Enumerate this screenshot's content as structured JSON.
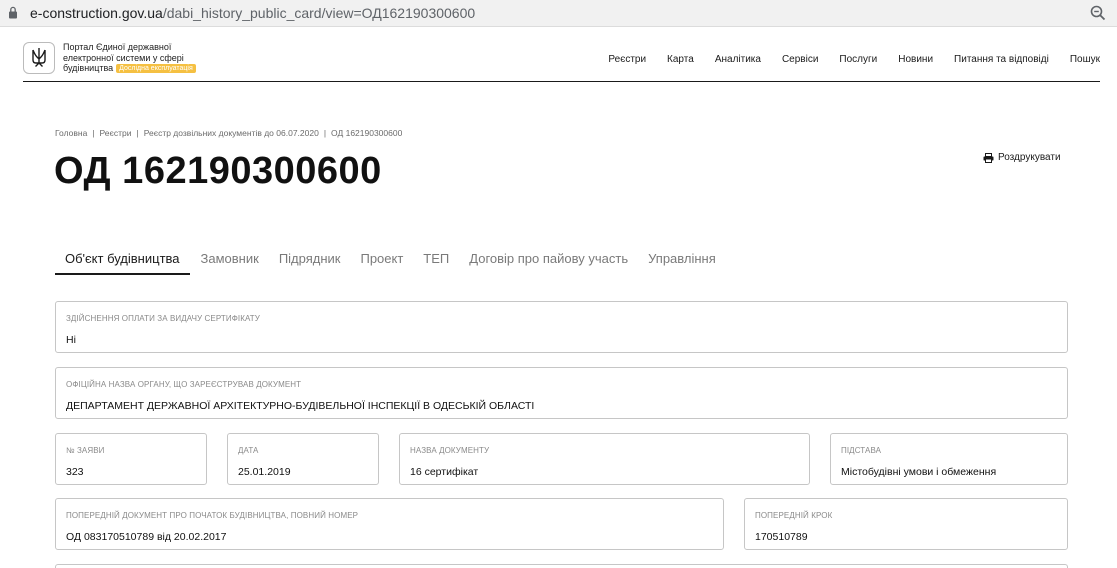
{
  "browser": {
    "url_domain": "e-construction.gov.ua",
    "url_path": "/dabi_history_public_card/view=ОД162190300600"
  },
  "header": {
    "portal_line1": "Портал Єдиної державної",
    "portal_line2": "електронної системи у сфері",
    "portal_line3": "будівництва",
    "badge": "Дослідна експлуатація",
    "nav": [
      "Реєстри",
      "Карта",
      "Аналітика",
      "Сервіси",
      "Послуги",
      "Новини",
      "Питання та відповіді",
      "Пошук"
    ]
  },
  "breadcrumb": [
    "Головна",
    "Реєстри",
    "Реєстр дозвільних документів до 06.07.2020",
    "ОД 162190300600"
  ],
  "page": {
    "title": "ОД 162190300600",
    "print_label": "Роздрукувати"
  },
  "tabs": [
    "Об'єкт будівництва",
    "Замовник",
    "Підрядник",
    "Проект",
    "ТЕП",
    "Договір про пайову участь",
    "Управління"
  ],
  "active_tab": "Об'єкт будівництва",
  "fields": {
    "payment": {
      "label": "Здійснення оплати за видачу сертифікату",
      "value": "Ні"
    },
    "authority": {
      "label": "Офіційна назва органу, що зареєстрував документ",
      "value": "ДЕПАРТАМЕНТ ДЕРЖАВНОЇ АРХІТЕКТУРНО-БУДІВЕЛЬНОЇ ІНСПЕКЦІЇ В ОДЕСЬКІЙ ОБЛАСТІ"
    },
    "application_no": {
      "label": "№ заяви",
      "value": "323"
    },
    "date": {
      "label": "Дата",
      "value": "25.01.2019"
    },
    "doc_name": {
      "label": "Назва документу",
      "value": "16 сертифікат"
    },
    "basis": {
      "label": "Підстава",
      "value": "Містобудівні умови і обмеження"
    },
    "prev_doc": {
      "label": "Попередній документ про початок будівництва, повний номер",
      "value": "ОД 083170510789 від 20.02.2017"
    },
    "prev_step": {
      "label": "Попередній крок",
      "value": "170510789"
    }
  }
}
